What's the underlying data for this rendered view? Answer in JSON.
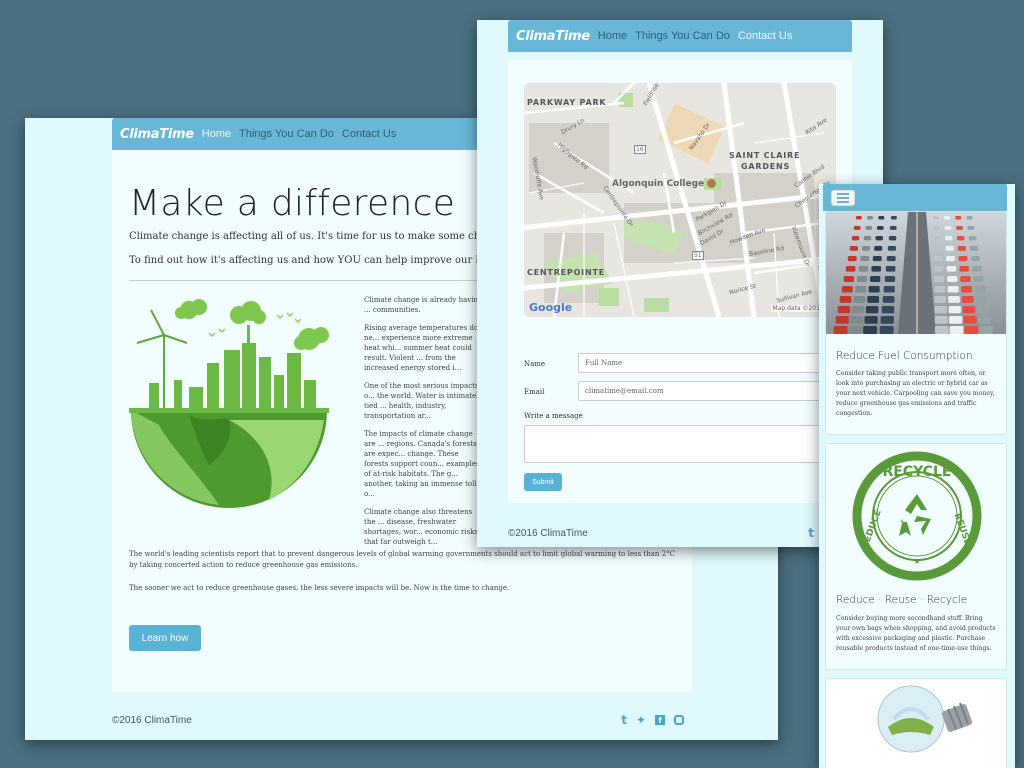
{
  "brand": "ClimaTime",
  "nav": {
    "home": "Home",
    "things": "Things You Can Do",
    "contact": "Contact Us"
  },
  "home": {
    "title": "Make a difference",
    "lead1": "Climate change is affecting all of us. It's time for us to make some changes.",
    "lead2": "To find out how it's affecting us and how YOU can help improve our home planet, pl",
    "col": [
      "Climate change is already having ... communities.",
      "Rising average temperatures do ne... experience more extreme heat whi... summer heat could result. Violent ... from the increased energy stored i...",
      "One of the most serious impacts o... the world. Water is intimately tied ... health, industry, transportation ar...",
      "The impacts of climate change are ... regions. Canada's forests are expec... change. These forests support coun... examples of at-risk habitats. The g... another, taking an immense toll o...",
      "Climate change also threatens the ... disease, freshwater shortages, wor... economic risks that far outweigh t..."
    ],
    "para1": "The world's leading scientists report that to prevent dangerous levels of global warming governments should act to limit global warming to less than 2°C by taking concerted action to reduce greenhouse gas emissions.",
    "para2": "The sooner we act to reduce greenhouse gases, the less severe impacts will be. Now is the time to change.",
    "learn_btn": "Learn how",
    "footer_copy": "©2016 ClimaTime"
  },
  "contact": {
    "map": {
      "labels": {
        "parkway_park": "PARKWAY PARK",
        "saint_claire": "SAINT CLAIRE",
        "gardens": "GARDENS",
        "algonquin": "Algonquin College",
        "centrepointe": "CENTREPOINTE",
        "google": "Google",
        "map_data": "Map data ©2018 Go"
      },
      "streets": {
        "drury": "Drury Ln",
        "highgate": "Highgate Rd",
        "navaho": "Navaho Dr",
        "centrepointe_dr": "Centrepointe Dr",
        "woodroffe": "Woodroffe Ave",
        "parkglen": "Parkglen Dr",
        "birchview": "Birchview Rd",
        "david": "David Dr",
        "howden": "Howden Ave",
        "norice": "Norice St",
        "sullivan": "Sullivan Ave",
        "rita": "Rita Ave",
        "canter": "Canter Blvd",
        "chesterton": "Chesterton Dr",
        "viewmount": "Viewmount Dr",
        "baseline": "Baseline Rd",
        "fieldrise": "Fieldrise",
        "route16": "16",
        "route51": "51"
      }
    },
    "name_label": "Name",
    "name_placeholder": "Full Name",
    "email_label": "Email",
    "email_placeholder": "climatime@email.com",
    "message_label": "Write a message",
    "submit_btn": "Submit",
    "footer_copy": "©2016 ClimaTime"
  },
  "mobile": {
    "cards": [
      {
        "title": "Reduce Fuel Consumption",
        "text": "Consider taking public transport more often, or look into purchasing an electric or hybrid car as your next vehicle. Carpooling can save you money, reduce greenhouse gas emissions and traffic congestion."
      },
      {
        "title": "Reduce · Reuse · Recycle",
        "text": "Consider buying more secondhand stuff. Bring your own bags when shopping, and avoid products with excessive packaging and plastic. Purchase reusable products instead of one-time-use things."
      }
    ],
    "stamp": {
      "recycle": "RECYCLE",
      "reduce": "REDUCE",
      "reuse": "REUSE"
    }
  },
  "social_icons": [
    "tumblr-icon",
    "twitter-icon",
    "facebook-icon",
    "instagram-icon"
  ],
  "colors": {
    "navbar": "#68b7d7",
    "page_bg": "#dff9fc",
    "button": "#5ab2d4",
    "desktop": "#4a7081"
  }
}
